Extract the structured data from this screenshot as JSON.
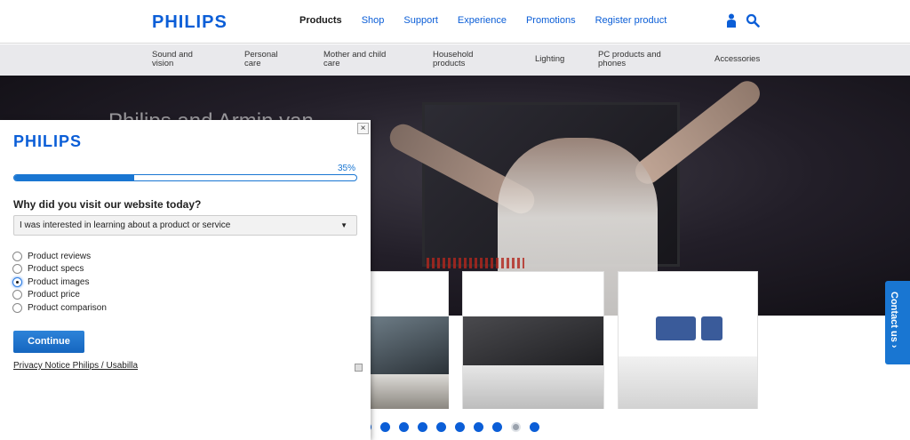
{
  "header": {
    "logo": "PHILIPS",
    "nav": [
      {
        "label": "Products",
        "active": true
      },
      {
        "label": "Shop",
        "active": false
      },
      {
        "label": "Support",
        "active": false
      },
      {
        "label": "Experience",
        "active": false
      },
      {
        "label": "Promotions",
        "active": false
      },
      {
        "label": "Register product",
        "active": false
      }
    ],
    "icons": [
      "user-icon",
      "search-icon"
    ]
  },
  "subnav": [
    {
      "line1": "Sound and",
      "line2": "vision"
    },
    {
      "line1": "Personal",
      "line2": "care"
    },
    {
      "line1": "Mother and child",
      "line2": "care"
    },
    {
      "line1": "Household",
      "line2": "products"
    },
    {
      "line1": "Lighting",
      "line2": ""
    },
    {
      "line1": "PC products and",
      "line2": "phones"
    },
    {
      "line1": "Accessories",
      "line2": ""
    }
  ],
  "hero": {
    "title_fragment": "Philips and Armin van"
  },
  "carousel": {
    "active_index": 0,
    "count": 10
  },
  "contact": {
    "label": "Contact us ›"
  },
  "survey": {
    "logo": "PHILIPS",
    "progress_percent": 35,
    "progress_label": "35%",
    "question": "Why did you visit our website today?",
    "selected_option": "I was interested in learning about a product or service",
    "options": [
      {
        "label": "Product reviews",
        "checked": false
      },
      {
        "label": "Product specs",
        "checked": false
      },
      {
        "label": "Product images",
        "checked": true
      },
      {
        "label": "Product price",
        "checked": false
      },
      {
        "label": "Product comparison",
        "checked": false
      }
    ],
    "continue_label": "Continue",
    "privacy_label": "Privacy Notice Philips / Usabilla",
    "close_label": "×"
  },
  "colors": {
    "brand_blue": "#0b5ed7",
    "button_blue": "#1976d2",
    "subnav_bg": "#e9e9ec"
  }
}
